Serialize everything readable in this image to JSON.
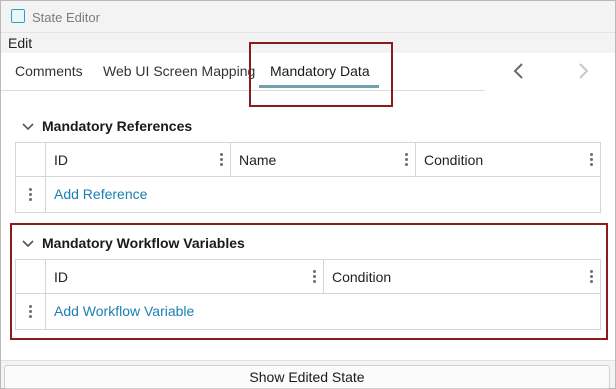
{
  "window": {
    "title": "State Editor"
  },
  "menu": {
    "items": [
      "Edit"
    ]
  },
  "tabs": [
    {
      "label": "Comments",
      "active": false
    },
    {
      "label": "Web UI Screen Mapping",
      "active": false
    },
    {
      "label": "Mandatory Data",
      "active": true
    }
  ],
  "nav": {
    "prev_icon": "chevron-left-icon",
    "next_icon": "chevron-right-icon"
  },
  "sections": {
    "references": {
      "title": "Mandatory References",
      "columns": [
        "ID",
        "Name",
        "Condition"
      ],
      "rows": [],
      "add_label": "Add Reference"
    },
    "workflow_variables": {
      "title": "Mandatory Workflow Variables",
      "columns": [
        "ID",
        "Condition"
      ],
      "rows": [],
      "add_label": "Add Workflow Variable"
    }
  },
  "footer": {
    "button_label": "Show Edited State"
  },
  "colors": {
    "accent_link": "#1a7fb3",
    "highlight_box": "#8e1b1b",
    "tab_underline": "#6fa2ad",
    "app_icon": "#2aa3c5"
  }
}
